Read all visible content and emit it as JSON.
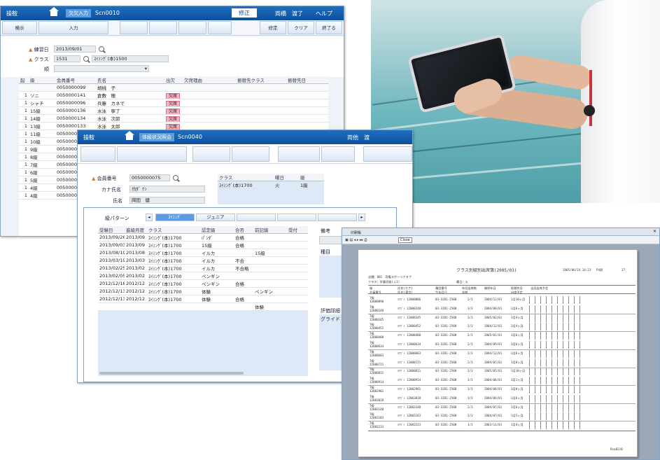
{
  "colors": {
    "titlebar": "#0d4f9d",
    "breadcrumb": "#5c9de0",
    "absent": "#f6b1c0",
    "required": "#e67817",
    "report_bg": "#9aa8b8"
  },
  "photo": {
    "alt_icon": "tablet-poolside-photo"
  },
  "w1": {
    "app": "操鞍",
    "breadcrumb": "欠欠入力",
    "screen_id": "Scn0010",
    "top_right": {
      "edit": "修正",
      "user": "両橋　渡了",
      "help": "ヘルプ"
    },
    "fn_buttons": [
      "検示",
      "入力",
      "",
      "",
      "",
      "",
      "修定",
      "クリア",
      "終了る"
    ],
    "date_label": "練習日",
    "date_value": "2013/09/01",
    "class_label": "クラス",
    "class_code": "1531",
    "class_name": "ｽｲﾐﾝｸﾞ(本)1500",
    "row3_label": "順",
    "headers": [
      "起",
      "級",
      "会員番号",
      "氏名",
      "出欠",
      "欠席理由",
      "振替先クラス",
      "振替先日"
    ],
    "rows": [
      {
        "no": "",
        "grade": "",
        "id": "0050000099",
        "name": "胡桃　子",
        "att": ""
      },
      {
        "no": "1",
        "grade": "ソニ",
        "id": "0050000141",
        "name": "倉敷　穂",
        "att": "欠席"
      },
      {
        "no": "1",
        "grade": "シャチ",
        "id": "0050000096",
        "name": "兵藤　カネで",
        "att": "欠席"
      },
      {
        "no": "1",
        "grade": "15級",
        "id": "0050000136",
        "name": "水泳　寧了",
        "att": "欠席"
      },
      {
        "no": "1",
        "grade": "14級",
        "id": "0050000134",
        "name": "水泳　次郎",
        "att": "欠席"
      },
      {
        "no": "1",
        "grade": "13級",
        "id": "0050000133",
        "name": "水泳　太郎",
        "att": "欠席"
      },
      {
        "no": "1",
        "grade": "11級",
        "id": "0050000",
        "name": "",
        "att": ""
      },
      {
        "no": "1",
        "grade": "10級",
        "id": "0050000",
        "name": "",
        "att": ""
      },
      {
        "no": "1",
        "grade": "9級",
        "id": "0050000",
        "name": "",
        "att": ""
      },
      {
        "no": "1",
        "grade": "8級",
        "id": "0050000",
        "name": "",
        "att": ""
      },
      {
        "no": "1",
        "grade": "7級",
        "id": "0050000",
        "name": "",
        "att": ""
      },
      {
        "no": "1",
        "grade": "6級",
        "id": "0050000",
        "name": "",
        "att": ""
      },
      {
        "no": "1",
        "grade": "5級",
        "id": "0050000",
        "name": "",
        "att": ""
      },
      {
        "no": "1",
        "grade": "4級",
        "id": "0050000",
        "name": "",
        "att": ""
      },
      {
        "no": "1",
        "grade": "4級",
        "id": "0050000",
        "name": "",
        "att": ""
      }
    ]
  },
  "w2": {
    "app": "操鞍",
    "breadcrumb": "体級状況照会",
    "screen_id": "Scn0040",
    "top_right": "両他　渡",
    "member_label": "会員番号",
    "member_value": "0050000075",
    "kana_label": "カナ氏名",
    "kana_value": "ｵｶﾀﾞ ｹﾝ",
    "name_label": "氏名",
    "name_value": "岡田　健",
    "class_headers": [
      "クラス",
      "曜日",
      "級"
    ],
    "class_row": [
      "ｽｲﾐﾝｸﾞ(本)1700",
      "火",
      "1級"
    ],
    "pattern_label": "級パターン",
    "tabs": [
      "ｽｲﾐﾝｸﾞ",
      "ジュニア",
      "",
      "",
      ""
    ],
    "side_labels": [
      "備考",
      "種目",
      "評価詳細"
    ],
    "side_value": "グライド キック",
    "headers": [
      "受験日",
      "進級月度",
      "クラス",
      "認定級",
      "合否",
      "前記級",
      "受付"
    ],
    "rows": [
      [
        "2013/09/26",
        "2013/09",
        "ｽｲﾐﾝｸﾞ(本)1700",
        "ﾊﾟﾝﾀﾞ",
        "合格",
        "",
        ""
      ],
      [
        "2013/09/03",
        "2013/09",
        "ｽｲﾐﾝｸﾞ(本)1700",
        "15級",
        "合格",
        "",
        ""
      ],
      [
        "2013/08/19",
        "2013/08",
        "ｽｲﾐﾝｸﾞ(本)1700",
        "イルカ",
        "",
        "15級",
        ""
      ],
      [
        "2013/03/19",
        "2013/03",
        "ｽｲﾐﾝｸﾞ(本)1700",
        "イルカ",
        "不合",
        "",
        ""
      ],
      [
        "2013/02/25",
        "2013/02",
        "ｽｲﾐﾝｸﾞ(本)1700",
        "イルカ",
        "不合格",
        "",
        ""
      ],
      [
        "2013/02/05",
        "2013/02",
        "ｽｲﾐﾝｸﾞ(本)1700",
        "ペンギン",
        "",
        "",
        ""
      ],
      [
        "2012/12/18",
        "2012/12",
        "ｽｲﾐﾝｸﾞ(本)1700",
        "ペンギン",
        "合格",
        "",
        ""
      ],
      [
        "2012/12/13",
        "2012/12",
        "ｽｲﾐﾝｸﾞ(本)1700",
        "体験",
        "",
        "ペンギン",
        ""
      ],
      [
        "2012/12/13",
        "2012/12",
        "ｽｲﾐﾝｸﾞ(本)1700",
        "体験",
        "合格",
        "",
        ""
      ],
      [
        "",
        "",
        "",
        "",
        "",
        "体験",
        ""
      ]
    ]
  },
  "w3": {
    "window_title": "印刷帳",
    "close_label": "Close",
    "report_title": "クラス別級別出席簿(2005/03)",
    "print_time": "2005/06/24 14:23",
    "page_label": "P4頁",
    "page_no": "27",
    "school": "店舗：801　両備スポーツクラブ",
    "class_line": "クラス：学童初級(ふ1)",
    "day_line": "曜日：火",
    "headers": [
      "級\n会員番号",
      "氏名(カナ)\n氏名(漢字)",
      "電話番号\n生年月日",
      "先月出席数\n年齢",
      "継続年月",
      "振替先月\n出席予定",
      "当月出席予定"
    ],
    "footer": "Rsa0210",
    "grade": "7級",
    "rows": [
      [
        "12000090",
        "ﾊﾏｿﾞﾉ 12000086",
        "03-3281-2500",
        "2/3",
        "2004/12/01",
        "1月10ヶ月"
      ],
      [
        "12000240",
        "ﾊﾏｿﾞﾉ 12000240",
        "03-3281-2500",
        "3/3",
        "2004/08/01",
        "3月6ヶ月"
      ],
      [
        "12000345",
        "ﾊﾏｿﾞﾉ 12000345",
        "03-3281-2500",
        "3/3",
        "2005/02/01",
        "3月4ヶ月"
      ],
      [
        "12000452",
        "ﾊﾏｿﾞﾉ 12000452",
        "03-3281-2500",
        "2/3",
        "2004/12/01",
        "3月4ヶ月"
      ],
      [
        "12000480",
        "ﾊﾏｿﾞﾉ 12000480",
        "03-3281-2500",
        "2/3",
        "2005/01/01",
        "3月6ヶ月"
      ],
      [
        "12000634",
        "ﾊﾏｿﾞﾉ 12000634",
        "03-3281-2500",
        "2/3",
        "2004/09/01",
        "3月6ヶ月"
      ],
      [
        "12000683",
        "ﾊﾏｿﾞﾉ 12000683",
        "03-3281-2500",
        "2/3",
        "2004/12/01",
        "3月6ヶ月"
      ],
      [
        "12000721",
        "ﾊﾏｿﾞﾉ 12000721",
        "03-3281-2500",
        "2/3",
        "2004/07/01",
        "1月8ヶ月"
      ],
      [
        "12000811",
        "ﾊﾏｿﾞﾉ 12000811",
        "03-3281-2500",
        "2/3",
        "2005/05/01",
        "1月10ヶ月"
      ],
      [
        "12000914",
        "ﾊﾏｿﾞﾉ 12000914",
        "03-3281-2500",
        "3/3",
        "2004/06/01",
        "3月1ヶ月"
      ],
      [
        "12002901",
        "ﾊﾏｿﾞﾉ 12002901",
        "03-3281-2500",
        "3/3",
        "2004/08/01",
        "3月8ヶ月"
      ],
      [
        "12003018",
        "ﾊﾏｿﾞﾉ 12003018",
        "03-3281-2500",
        "3/3",
        "2004/06/01",
        "3月6ヶ月"
      ],
      [
        "12003148",
        "ﾊﾏｿﾞﾉ 12003148",
        "03-3281-2500",
        "2/3",
        "2004/07/01",
        "3月6ヶ月"
      ],
      [
        "12003183",
        "ﾊﾏｿﾞﾉ 12003183",
        "03-3281-2500",
        "2/3",
        "2004/07/01",
        "1月5ヶ月"
      ],
      [
        "12003233",
        "ﾊﾏｿﾞﾉ 12003233",
        "03-3281-2500",
        "1/3",
        "2003/11/01",
        "1月4ヶ月"
      ]
    ]
  }
}
